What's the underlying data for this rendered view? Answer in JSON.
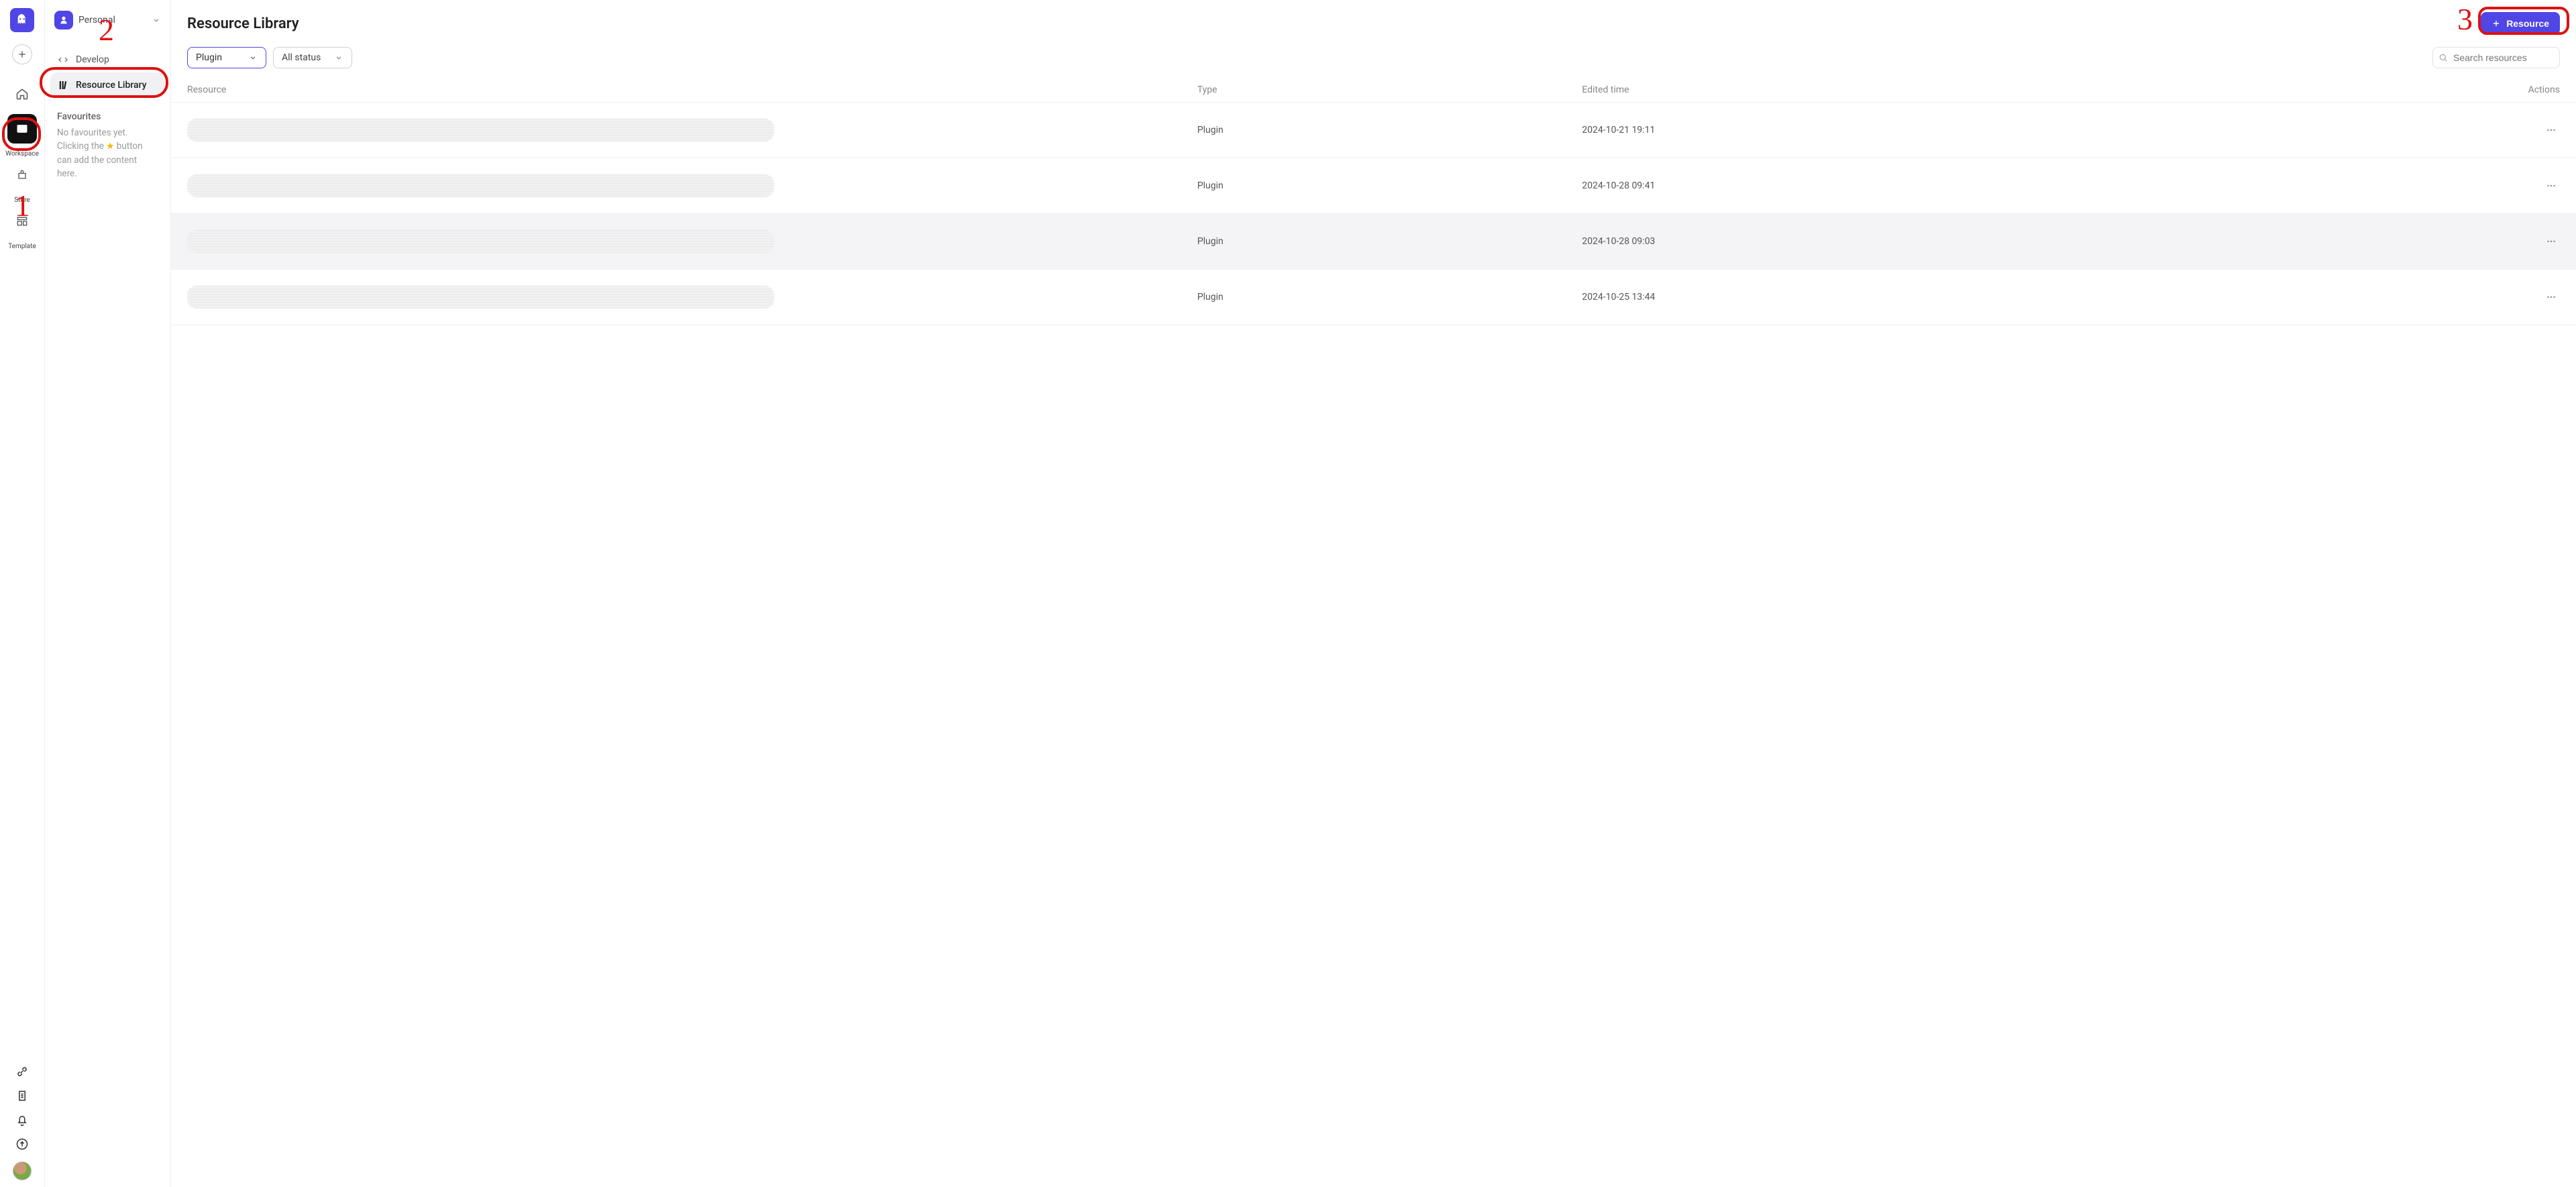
{
  "rail": {
    "items": [
      {
        "id": "home",
        "label": ""
      },
      {
        "id": "workspace",
        "label": "Workspace"
      },
      {
        "id": "store",
        "label": "Store"
      },
      {
        "id": "template",
        "label": "Template"
      }
    ]
  },
  "annotations": {
    "n1": "1",
    "n2": "2",
    "n3": "3"
  },
  "sidebar": {
    "workspace_name": "Personal",
    "links": [
      {
        "icon": "code",
        "label": "Develop"
      },
      {
        "icon": "library",
        "label": "Resource Library",
        "active": true
      }
    ],
    "favourites_title": "Favourites",
    "favourites_empty_1": "No favourites yet.",
    "favourites_empty_2a": "Clicking the ",
    "favourites_empty_2b": " button can add the content here."
  },
  "page": {
    "title": "Resource Library",
    "add_button": "Resource",
    "filter_type": "Plugin",
    "filter_status": "All status",
    "search_placeholder": "Search resources"
  },
  "table": {
    "columns": {
      "resource": "Resource",
      "type": "Type",
      "edited": "Edited time",
      "actions": "Actions"
    },
    "rows": [
      {
        "type": "Plugin",
        "edited": "2024-10-21 19:11"
      },
      {
        "type": "Plugin",
        "edited": "2024-10-28 09:41"
      },
      {
        "type": "Plugin",
        "edited": "2024-10-28 09:03",
        "hovered": true
      },
      {
        "type": "Plugin",
        "edited": "2024-10-25 13:44"
      }
    ]
  }
}
